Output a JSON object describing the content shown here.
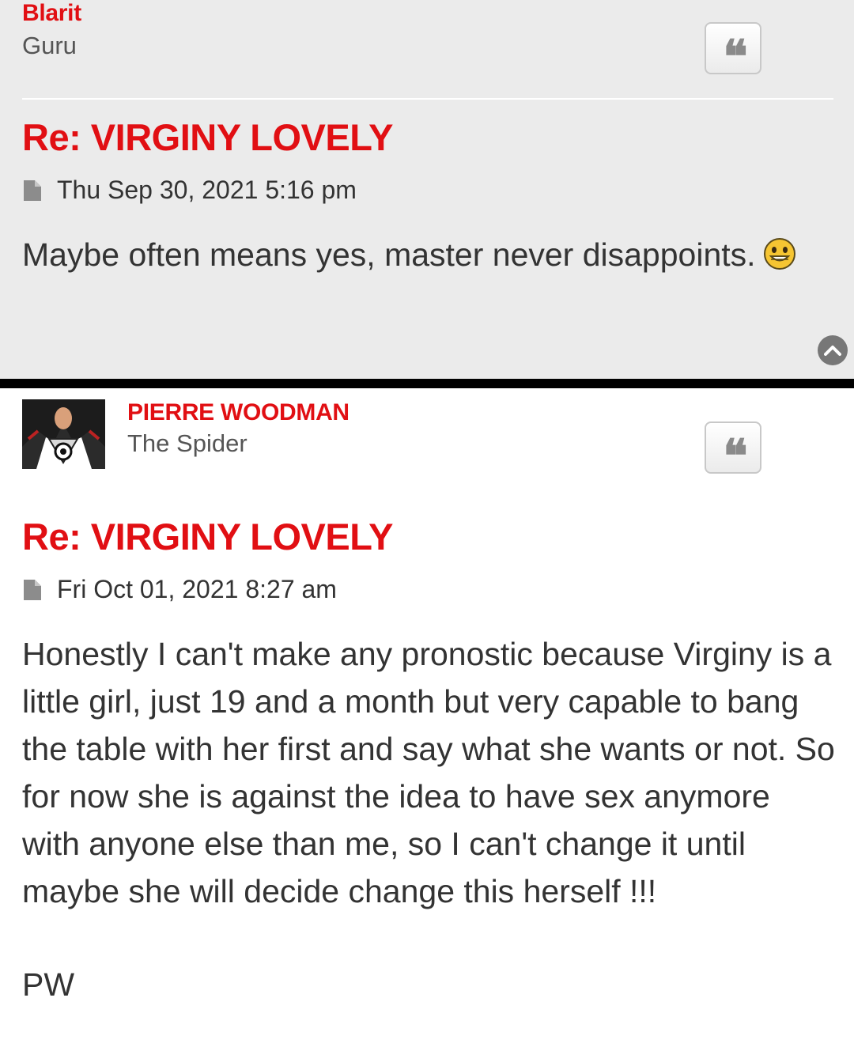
{
  "posts": [
    {
      "username": "Blarit",
      "rank": "Guru",
      "title": "Re: VIRGINY LOVELY",
      "date": "Thu Sep 30, 2021 5:16 pm",
      "content": "Maybe often means yes, master never disappoints.",
      "emoji": "smiling-face-icon",
      "quote_icon": "quote-icon"
    },
    {
      "username": "PIERRE WOODMAN",
      "rank": "The Spider",
      "title": "Re: VIRGINY LOVELY",
      "date": "Fri Oct 01, 2021 8:27 am",
      "content": "Honestly I can't make any pronostic because Virginy is a little girl, just 19 and a month but very capable to bang the table with her first and say what she wants or not. So for now she is against the idea to have sex anymore with anyone else than me, so I can't change it until maybe she will decide change this herself !!!",
      "signature": "PW",
      "quote_icon": "quote-icon"
    }
  ],
  "colors": {
    "accent": "#e10f13",
    "post_bg_alt": "#ebebeb",
    "text": "#333333"
  },
  "icons": {
    "back_to_top": "chevron-up-icon",
    "post_file": "file-icon"
  }
}
